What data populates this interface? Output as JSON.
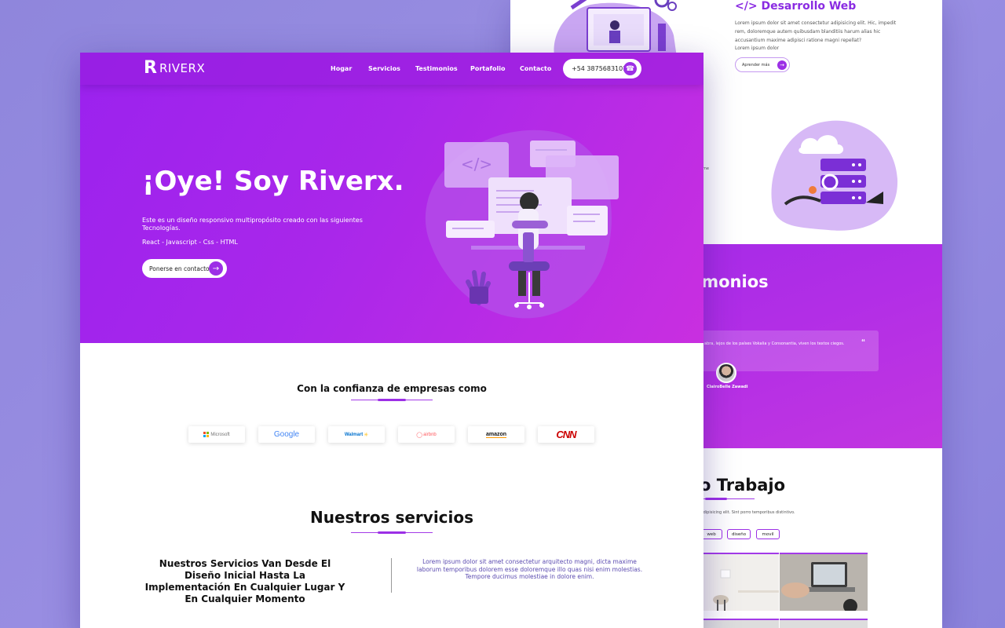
{
  "back": {
    "dev_title": "</> Desarrollo Web",
    "dev_text": "Lorem ipsum dolor sit amet consectetur adipisicing elit. Hic, impedit rem, doloremque autem quibusdam blanditiis harum alias hic accusantium maxime adipisci ratione magni repellat?",
    "dev_text2": "Lorem ipsum dolor",
    "learn_more": "Aprender más",
    "side_fragment": "me",
    "testimonials_title": "timonios",
    "testimonial_text": "abra, lejos de los países Vokalia y Consonantia, viven los textos ciegos.",
    "testimonial_quote": "“",
    "testimonial_name": "ClairoBelle Zawadi",
    "work_title": "no Trabajo",
    "work_sub": "ctetur adipisicing elit. Sint porro temporibus distintivo.",
    "filters": [
      "web",
      "diseño",
      "movil"
    ]
  },
  "nav": {
    "logo_mark": "R",
    "logo_text": "RIVERX",
    "links": [
      "Hogar",
      "Servicios",
      "Testimonios",
      "Portafolio",
      "Contacto"
    ],
    "phone": "+54 3875683101",
    "phone_icon": "phone-icon"
  },
  "hero": {
    "title": "¡Oye! Soy Riverx.",
    "description": "Este es un diseño responsivo multipropósito creado con las siguientes Tecnologías.",
    "tech": "React - Javascript - Css - HTML",
    "cta": "Ponerse en contacto",
    "illus_code": "</>"
  },
  "trust": {
    "title": "Con la confianza de empresas como",
    "brands": [
      "Microsoft",
      "Google",
      "Walmart",
      "airbnb",
      "amazon",
      "CNN"
    ]
  },
  "services": {
    "title": "Nuestros servicios",
    "headline": "Nuestros Servicios Van Desde El Diseño Inicial Hasta La Implementación En Cualquier Lugar Y En Cualquier Momento",
    "text": "Lorem ipsum dolor sit amet consectetur arquitecto magni, dicta maxime laborum temporibus dolorem esse doloremque illo quas nisi enim molestias. Tempore ducimus molestiae in dolore enim."
  },
  "colors": {
    "accent": "#9c2fe6",
    "hero_start": "#9b22ee",
    "hero_end": "#c92fe0",
    "background": "#8f86dc"
  }
}
